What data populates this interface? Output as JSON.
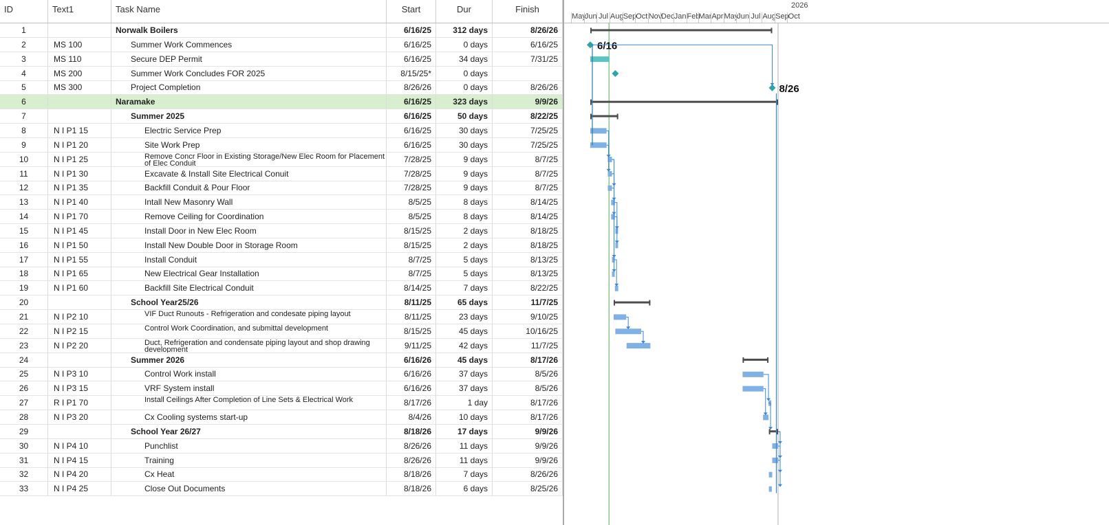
{
  "columns": {
    "id": "ID",
    "text1": "Text1",
    "task": "Task Name",
    "start": "Start",
    "dur": "Dur",
    "finish": "Finish"
  },
  "timeline": {
    "year_label": "2026",
    "months": [
      "May",
      "Jun",
      "Jul",
      "Aug",
      "Sep",
      "Oct",
      "Nov",
      "Dec",
      "Jan",
      "Feb",
      "Mar",
      "Apr",
      "May",
      "Jun",
      "Jul",
      "Aug",
      "Sep",
      "Oct"
    ]
  },
  "milestone_labels": {
    "m2": "6/16",
    "m5": "8/26"
  },
  "colors": {
    "summary_bar": "#4d4d4d",
    "task_bar": "#7fb0e6",
    "critical_bar": "#5bc4c4",
    "milestone": "#2aa6a6",
    "link": "#3a86d4",
    "today_line": "#8bc78a",
    "highlight_row": "#d7efcf"
  },
  "rows": [
    {
      "id": "1",
      "text1": "",
      "name": "Norwalk Boilers",
      "start": "6/16/25",
      "dur": "312 days",
      "finish": "8/26/26",
      "bold": true,
      "level": 0
    },
    {
      "id": "2",
      "text1": "MS 100",
      "name": "Summer Work Commences",
      "start": "6/16/25",
      "dur": "0 days",
      "finish": "6/16/25",
      "level": 1
    },
    {
      "id": "3",
      "text1": "MS 110",
      "name": "Secure DEP Permit",
      "start": "6/16/25",
      "dur": "34 days",
      "finish": "7/31/25",
      "level": 1
    },
    {
      "id": "4",
      "text1": "MS 200",
      "name": "Summer Work Concludes FOR 2025",
      "start": "8/15/25*",
      "dur": "0 days",
      "finish": "",
      "level": 1
    },
    {
      "id": "5",
      "text1": "MS 300",
      "name": "Project Completion",
      "start": "8/26/26",
      "dur": "0 days",
      "finish": "8/26/26",
      "level": 1
    },
    {
      "id": "6",
      "text1": "",
      "name": "Naramake",
      "start": "6/16/25",
      "dur": "323 days",
      "finish": "9/9/26",
      "bold": true,
      "level": 0,
      "highlight": true
    },
    {
      "id": "7",
      "text1": "",
      "name": "Summer 2025",
      "start": "6/16/25",
      "dur": "50 days",
      "finish": "8/22/25",
      "bold": true,
      "level": 1
    },
    {
      "id": "8",
      "text1": "N I P1 15",
      "name": "Electric Service Prep",
      "start": "6/16/25",
      "dur": "30 days",
      "finish": "7/25/25",
      "level": 2
    },
    {
      "id": "9",
      "text1": "N I P1 20",
      "name": "Site Work Prep",
      "start": "6/16/25",
      "dur": "30 days",
      "finish": "7/25/25",
      "level": 2
    },
    {
      "id": "10",
      "text1": "N I P1 25",
      "name": "Remove Concr Floor in Existing Storage/New Elec Room for Placement of Elec Conduit",
      "start": "7/28/25",
      "dur": "9 days",
      "finish": "8/7/25",
      "level": 2,
      "two": true
    },
    {
      "id": "11",
      "text1": "N I P1 30",
      "name": "Excavate & Install Site Electrical Conuit",
      "start": "7/28/25",
      "dur": "9 days",
      "finish": "8/7/25",
      "level": 2
    },
    {
      "id": "12",
      "text1": "N I P1 35",
      "name": "Backfill Conduit & Pour Floor",
      "start": "7/28/25",
      "dur": "9 days",
      "finish": "8/7/25",
      "level": 2
    },
    {
      "id": "13",
      "text1": "N I P1 40",
      "name": "Intall New Masonry Wall",
      "start": "8/5/25",
      "dur": "8 days",
      "finish": "8/14/25",
      "level": 2
    },
    {
      "id": "14",
      "text1": "N I P1 70",
      "name": "Remove Ceiling for Coordination",
      "start": "8/5/25",
      "dur": "8 days",
      "finish": "8/14/25",
      "level": 2
    },
    {
      "id": "15",
      "text1": "N I P1 45",
      "name": "Install Door in New Elec Room",
      "start": "8/15/25",
      "dur": "2 days",
      "finish": "8/18/25",
      "level": 2
    },
    {
      "id": "16",
      "text1": "N I P1 50",
      "name": "Install New Double Door in Storage Room",
      "start": "8/15/25",
      "dur": "2 days",
      "finish": "8/18/25",
      "level": 2
    },
    {
      "id": "17",
      "text1": "N I P1 55",
      "name": "Install Conduit",
      "start": "8/7/25",
      "dur": "5 days",
      "finish": "8/13/25",
      "level": 2
    },
    {
      "id": "18",
      "text1": "N I P1 65",
      "name": "New Electrical Gear Installation",
      "start": "8/7/25",
      "dur": "5 days",
      "finish": "8/13/25",
      "level": 2
    },
    {
      "id": "19",
      "text1": "N I P1 60",
      "name": "Backfill Site Electrical Conduit",
      "start": "8/14/25",
      "dur": "7 days",
      "finish": "8/22/25",
      "level": 2
    },
    {
      "id": "20",
      "text1": "",
      "name": "School Year25/26",
      "start": "8/11/25",
      "dur": "65 days",
      "finish": "11/7/25",
      "bold": true,
      "level": 1
    },
    {
      "id": "21",
      "text1": "N I P2 10",
      "name": "VIF Duct Runouts - Refrigeration and condesate piping layout",
      "start": "8/11/25",
      "dur": "23 days",
      "finish": "9/10/25",
      "level": 2,
      "two": true
    },
    {
      "id": "22",
      "text1": "N I P2 15",
      "name": "Control Work Coordination, and submittal development",
      "start": "8/15/25",
      "dur": "45 days",
      "finish": "10/16/25",
      "level": 2,
      "two": true
    },
    {
      "id": "23",
      "text1": "N I P2 20",
      "name": "Duct, Refrigeration and condensate piping layout and shop drawing development",
      "start": "9/11/25",
      "dur": "42 days",
      "finish": "11/7/25",
      "level": 2,
      "two": true
    },
    {
      "id": "24",
      "text1": "",
      "name": "Summer 2026",
      "start": "6/16/26",
      "dur": "45 days",
      "finish": "8/17/26",
      "bold": true,
      "level": 1
    },
    {
      "id": "25",
      "text1": "N I P3 10",
      "name": "Control Work install",
      "start": "6/16/26",
      "dur": "37 days",
      "finish": "8/5/26",
      "level": 2
    },
    {
      "id": "26",
      "text1": "N I P3 15",
      "name": "VRF System install",
      "start": "6/16/26",
      "dur": "37 days",
      "finish": "8/5/26",
      "level": 2
    },
    {
      "id": "27",
      "text1": "R I P1 70",
      "name": "Install Ceilings After Completion of Line Sets & Electrical Work",
      "start": "8/17/26",
      "dur": "1 day",
      "finish": "8/17/26",
      "level": 2,
      "two": true
    },
    {
      "id": "28",
      "text1": "N I P3 20",
      "name": "Cx Cooling systems start-up",
      "start": "8/4/26",
      "dur": "10 days",
      "finish": "8/17/26",
      "level": 2
    },
    {
      "id": "29",
      "text1": "",
      "name": "School Year 26/27",
      "start": "8/18/26",
      "dur": "17 days",
      "finish": "9/9/26",
      "bold": true,
      "level": 1
    },
    {
      "id": "30",
      "text1": "N I P4 10",
      "name": "Punchlist",
      "start": "8/26/26",
      "dur": "11 days",
      "finish": "9/9/26",
      "level": 2
    },
    {
      "id": "31",
      "text1": "N I P4 15",
      "name": "Training",
      "start": "8/26/26",
      "dur": "11 days",
      "finish": "9/9/26",
      "level": 2
    },
    {
      "id": "32",
      "text1": "N I P4 20",
      "name": "Cx Heat",
      "start": "8/18/26",
      "dur": "7 days",
      "finish": "8/26/26",
      "level": 2
    },
    {
      "id": "33",
      "text1": "N I P4 25",
      "name": "Close Out Documents",
      "start": "8/18/26",
      "dur": "6 days",
      "finish": "8/25/26",
      "level": 2
    }
  ]
}
